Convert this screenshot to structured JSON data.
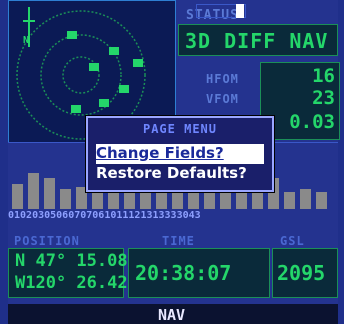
{
  "status": {
    "label": "STATUS",
    "value": "3D DIFF NAV"
  },
  "accuracy": {
    "hfom_label": "HFOM",
    "hfom_value": "16",
    "vfom_label": "VFOM",
    "vfom_value": "23",
    "third_value": "0.03"
  },
  "sky": {
    "north_label": "N"
  },
  "satellites": {
    "ids": "01020305060707061011121313333043",
    "levels": [
      0.45,
      0.65,
      0.55,
      0.35,
      0.4,
      0.3,
      0.55,
      0.65,
      0.55,
      0.35,
      0.3,
      0.45,
      0.55,
      0.4,
      0.45,
      0.35,
      0.55,
      0.3,
      0.35,
      0.3
    ]
  },
  "bottom": {
    "position_label": "POSITION",
    "time_label": "TIME",
    "gsl_label": "GSL",
    "lat": "N 47° 15.08'",
    "lon": "W120° 26.42'",
    "time": "20:38:07",
    "gsl": "2095"
  },
  "nav": {
    "label": "NAV"
  },
  "menu": {
    "title": "PAGE MENU",
    "items": [
      {
        "label": "Change Fields?"
      },
      {
        "label": "Restore Defaults?"
      }
    ]
  },
  "colors": {
    "background": "#24338f",
    "lcd_green": "#24d66a",
    "label_blue": "#5b7ad6",
    "menu_highlight": "#ffffff"
  }
}
